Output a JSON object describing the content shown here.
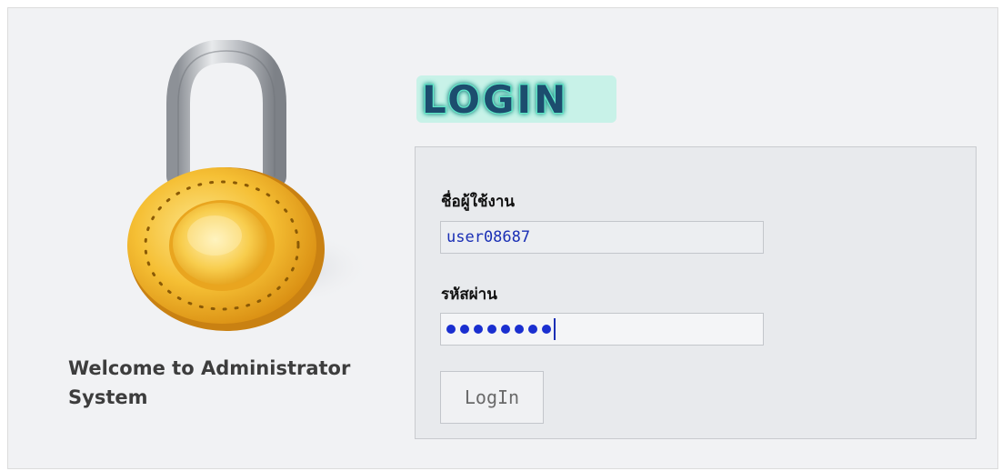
{
  "title": "LOGIN",
  "welcome": "Welcome to Administrator System",
  "form": {
    "username_label": "ชื่อผู้ใช้งาน",
    "username_value": "user08687",
    "password_label": "รหัสผ่าน",
    "password_length": 8,
    "login_button": "LogIn"
  },
  "colors": {
    "panel_bg": "#f1f2f4",
    "form_bg": "#e8eaed",
    "title_fill": "#1f4d6e",
    "title_glow": "#7ff0d8",
    "input_text": "#1a2fb5",
    "padlock_gold": "#f2b52a",
    "padlock_shackle": "#a9adb3"
  },
  "icons": {
    "padlock": "padlock-icon"
  }
}
